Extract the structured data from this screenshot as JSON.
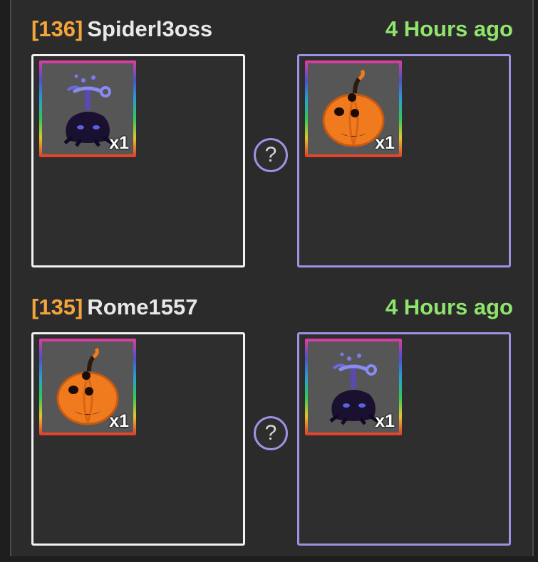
{
  "trades": [
    {
      "id": "[136]",
      "user": "Spiderl3oss",
      "time": "4 Hours ago",
      "left_item": {
        "icon": "shadow-fruit-icon",
        "qty": "x1"
      },
      "right_item": {
        "icon": "pumpkin-fruit-icon",
        "qty": "x1"
      },
      "question_symbol": "?"
    },
    {
      "id": "[135]",
      "user": "Rome1557",
      "time": "4 Hours ago",
      "left_item": {
        "icon": "pumpkin-fruit-icon",
        "qty": "x1"
      },
      "right_item": {
        "icon": "shadow-fruit-icon",
        "qty": "x1"
      },
      "question_symbol": "?"
    }
  ],
  "colors": {
    "trade_id": "#f3a43a",
    "time": "#8fe56b",
    "left_border": "#f2f2f2",
    "right_border": "#9c93e3"
  }
}
